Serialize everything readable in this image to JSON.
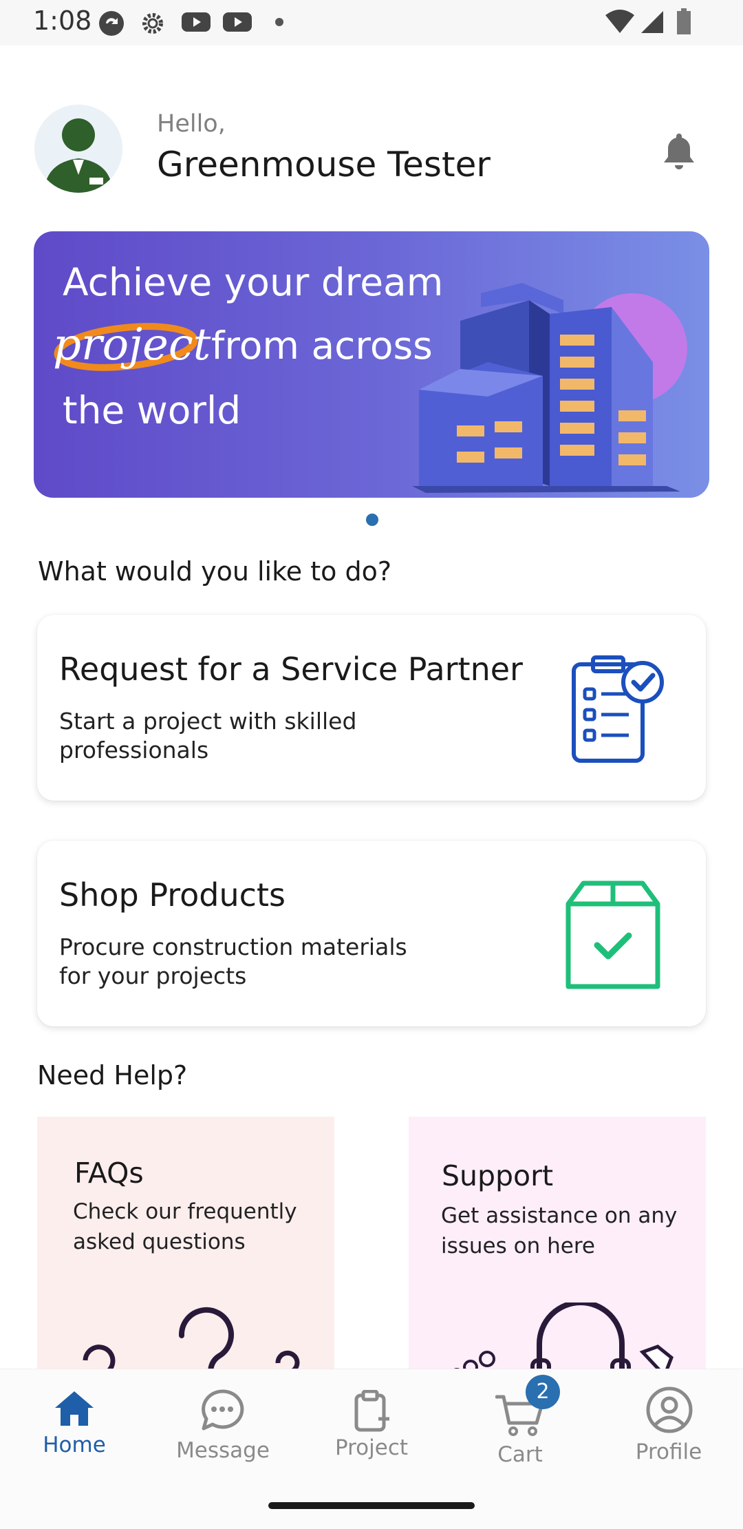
{
  "status_bar": {
    "time": "1:08"
  },
  "header": {
    "greeting": "Hello,",
    "user_name": "Greenmouse Tester"
  },
  "banner": {
    "line1": "Achieve your dream",
    "project_word": "project",
    "line2": "from across",
    "line3": "the world"
  },
  "sections": {
    "todo_title": "What would you like to do?",
    "help_title": "Need Help?"
  },
  "cards": {
    "service": {
      "title": "Request for a Service Partner",
      "description": "Start a project with skilled professionals"
    },
    "shop": {
      "title": "Shop Products",
      "description": "Procure construction materials for your projects"
    }
  },
  "help": {
    "faq": {
      "title": "FAQs",
      "description": "Check our frequently asked questions"
    },
    "support": {
      "title": "Support",
      "description": "Get assistance on any issues on here"
    }
  },
  "bottom_nav": {
    "home": "Home",
    "message": "Message",
    "project": "Project",
    "cart": "Cart",
    "cart_badge": "2",
    "profile": "Profile"
  },
  "colors": {
    "primary": "#2a6fb0",
    "nav_active": "#1f5ea8",
    "service_icon": "#1b4fbd",
    "shop_icon": "#1fbf7a",
    "faq_bg": "#fdeeee",
    "support_bg": "#fdeefa"
  },
  "icons": {
    "status": [
      "sync-icon",
      "settings-icon",
      "youtube-icon",
      "youtube-icon",
      "dot-icon",
      "wifi-icon",
      "signal-icon",
      "battery-icon"
    ],
    "header": "bell-icon",
    "service": "clipboard-checklist-icon",
    "shop": "box-check-icon",
    "nav": [
      "home-icon",
      "chat-bubble-icon",
      "clipboard-plus-icon",
      "cart-icon",
      "user-circle-icon"
    ]
  }
}
